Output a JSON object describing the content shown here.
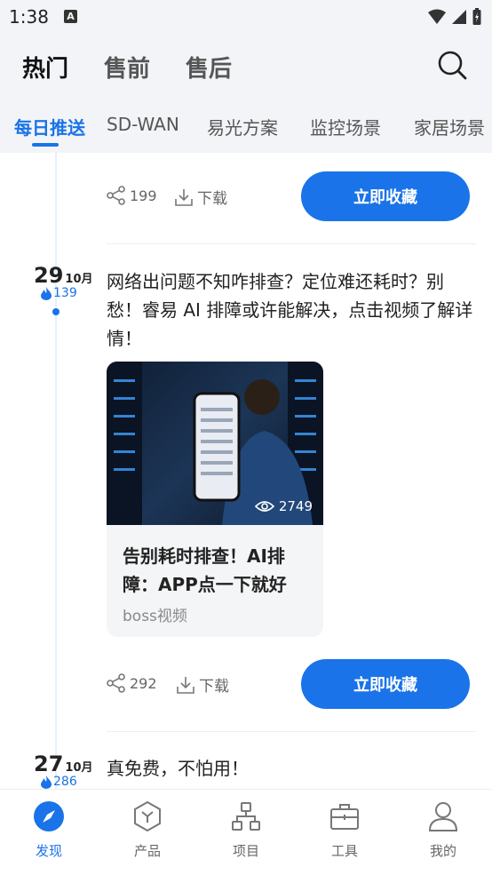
{
  "status_bar": {
    "time": "1:38",
    "notif_icon": "A"
  },
  "top_tabs": [
    "热门",
    "售前",
    "售后"
  ],
  "sub_tabs": [
    "每日推送",
    "SD-WAN",
    "易光方案",
    "监控场景",
    "家居场景"
  ],
  "feed": {
    "first_actions": {
      "share_count": "199",
      "download_label": "下载",
      "collect_label": "立即收藏"
    },
    "post_1": {
      "day": "29",
      "month": "10月",
      "heat": "139",
      "text": "网络出问题不知咋排查？定位难还耗时？别愁！睿易 AI 排障或许能解决，点击视频了解详情！",
      "video": {
        "views": "2749",
        "title": "告别耗时排查！AI排障：APP点一下就好",
        "source": "boss视频"
      },
      "actions": {
        "share_count": "292",
        "download_label": "下载",
        "collect_label": "立即收藏"
      }
    },
    "post_2": {
      "day": "27",
      "month": "10月",
      "heat": "286",
      "text": "真免费，不怕用！"
    }
  },
  "bottom_nav": [
    "发现",
    "产品",
    "项目",
    "工具",
    "我的"
  ],
  "colors": {
    "accent": "#1a73e8"
  }
}
